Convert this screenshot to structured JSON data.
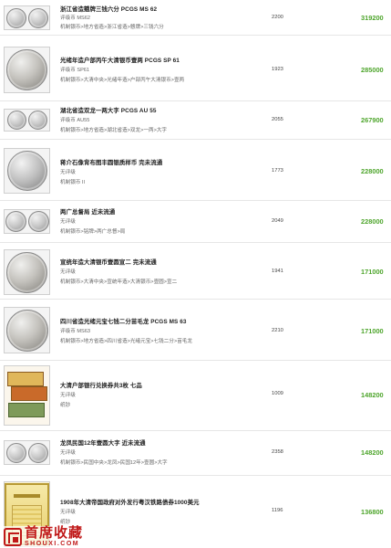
{
  "rows": [
    {
      "title": "浙江省造戆牌三钱六分 PCGS MS 62",
      "grade": "评级币 MS62",
      "category": "机制银币>地方省造>浙江省造>戆牌>三钱六分",
      "year": "2200",
      "price": "319200"
    },
    {
      "title": "光绪年造户部丙午大清银币壹两 PCGS SP 61",
      "grade": "评级币 SP61",
      "category": "机制银币>大清中央>光绪年造>户部丙午大清银币>壹两",
      "year": "1923",
      "price": "285000"
    },
    {
      "title": "湖北省造双龙一两大字 PCGS AU 55",
      "grade": "评级币 AU55",
      "category": "机制银币>地方省造>湖北省造>双龙>一两>大字",
      "year": "2055",
      "price": "267900"
    },
    {
      "title": "蒋介石像背布图丰圆银质样币 完未流通",
      "grade": "无评级",
      "category": "机制银币 II",
      "year": "1773",
      "price": "228000"
    },
    {
      "title": "两广总督局 近未流通",
      "grade": "无评级",
      "category": "机制银币>铭牌>两广总督>局",
      "year": "2049",
      "price": "228000"
    },
    {
      "title": "宣统年造大清银币壹圆宣二 完未流通",
      "grade": "无评级",
      "category": "机制银币>大清中央>宣统年造>大清银币>壹圆>宣二",
      "year": "1941",
      "price": "171000"
    },
    {
      "title": "四川省造光绪元宝七钱二分苗毛龙 PCGS MS 63",
      "grade": "评级币 MS63",
      "category": "机制银币>地方省造>四川省造>光绪元宝>七钱二分>苗毛龙",
      "year": "2210",
      "price": "171000"
    },
    {
      "title": "大清户部银行兑换券共3枚 七品",
      "grade": "无评级",
      "category": "纸钞",
      "year": "1009",
      "price": "148200"
    },
    {
      "title": "龙凤民国12年壹圆大字 近未流通",
      "grade": "无评级",
      "category": "机制银币>民国中央>龙凤>民国12年>壹圆>大字",
      "year": "2358",
      "price": "148200"
    },
    {
      "title": "1908年大清帝国政府对外发行粤汉铁路债券1000美元",
      "grade": "无评级",
      "category": "纸钞",
      "year": "1196",
      "price": "136800"
    }
  ],
  "watermark": {
    "cn": "首席收藏",
    "en": "SHOUXI.COM"
  }
}
